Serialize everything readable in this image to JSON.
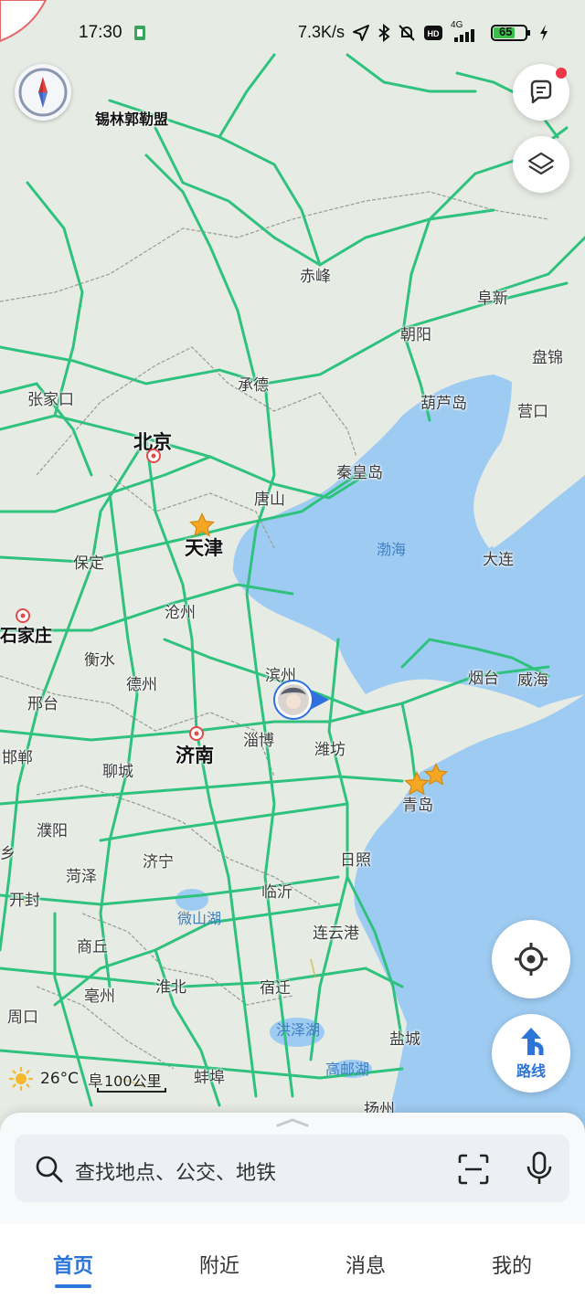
{
  "status_bar": {
    "time": "17:30",
    "net_speed": "7.3K/s",
    "signal": "4G",
    "battery": "65",
    "icons": [
      "location-arrow-icon",
      "bluetooth-icon",
      "mute-bell-icon",
      "hd-icon",
      "signal-icon",
      "battery-icon",
      "charging-icon"
    ]
  },
  "map": {
    "cities": [
      {
        "key": "xilinguole",
        "name": "锡林郭勒盟",
        "style": "label"
      },
      {
        "key": "chifeng",
        "name": "赤峰"
      },
      {
        "key": "fuxin",
        "name": "阜新"
      },
      {
        "key": "chaoyang",
        "name": "朝阳"
      },
      {
        "key": "panjin",
        "name": "盘锦"
      },
      {
        "key": "zhangjiakou",
        "name": "张家口"
      },
      {
        "key": "chengde",
        "name": "承德"
      },
      {
        "key": "huludao",
        "name": "葫芦岛"
      },
      {
        "key": "yingkou",
        "name": "营口"
      },
      {
        "key": "beijing",
        "name": "北京"
      },
      {
        "key": "qinhuangdao",
        "name": "秦皇岛"
      },
      {
        "key": "tangshan",
        "name": "唐山"
      },
      {
        "key": "tianjin",
        "name": "天津"
      },
      {
        "key": "baoding",
        "name": "保定"
      },
      {
        "key": "dalian",
        "name": "大连"
      },
      {
        "key": "cangzhou",
        "name": "沧州"
      },
      {
        "key": "shijiazhuang",
        "name": "石家庄"
      },
      {
        "key": "hengshui",
        "name": "衡水"
      },
      {
        "key": "binzhou",
        "name": "滨州"
      },
      {
        "key": "yantai",
        "name": "烟台"
      },
      {
        "key": "weihai",
        "name": "威海"
      },
      {
        "key": "dezhou",
        "name": "德州"
      },
      {
        "key": "xingtai",
        "name": "邢台"
      },
      {
        "key": "zibo",
        "name": "淄博"
      },
      {
        "key": "weifang",
        "name": "潍坊"
      },
      {
        "key": "jinan",
        "name": "济南"
      },
      {
        "key": "handan",
        "name": "邯郸"
      },
      {
        "key": "liaocheng",
        "name": "聊城"
      },
      {
        "key": "qingdao",
        "name": "青岛"
      },
      {
        "key": "puyang",
        "name": "濮阳"
      },
      {
        "key": "jining",
        "name": "济宁"
      },
      {
        "key": "rizhao",
        "name": "日照"
      },
      {
        "key": "heze",
        "name": "菏泽"
      },
      {
        "key": "linyi",
        "name": "临沂"
      },
      {
        "key": "kaifeng",
        "name": "开封"
      },
      {
        "key": "lianyungang",
        "name": "连云港"
      },
      {
        "key": "shangqiu",
        "name": "商丘"
      },
      {
        "key": "huaibei",
        "name": "淮北"
      },
      {
        "key": "suqian",
        "name": "宿迁"
      },
      {
        "key": "bozhou",
        "name": "亳州"
      },
      {
        "key": "zhoukou",
        "name": "周口"
      },
      {
        "key": "yancheng",
        "name": "盐城"
      },
      {
        "key": "bengbu",
        "name": "蚌埠"
      },
      {
        "key": "yangzhou",
        "name": "扬州"
      },
      {
        "key": "fuyang",
        "name": "阜"
      },
      {
        "key": "xiang",
        "name": "乡"
      }
    ],
    "water": {
      "bohai": "渤海",
      "weishan_lake": "微山湖",
      "hongze_lake": "洪泽湖",
      "gaoyou_lake": "高邮湖"
    }
  },
  "weather": {
    "temp": "26°C"
  },
  "scale": {
    "label": "100公里"
  },
  "route_button": {
    "label": "路线"
  },
  "search": {
    "placeholder": "查找地点、公交、地铁"
  },
  "tabs": [
    {
      "label": "首页",
      "active": true
    },
    {
      "label": "附近"
    },
    {
      "label": "消息"
    },
    {
      "label": "我的"
    }
  ],
  "colors": {
    "accent": "#2b74d8",
    "road": "#2fc27e",
    "sea": "#9ecbf2",
    "land": "#e6ebe3"
  }
}
